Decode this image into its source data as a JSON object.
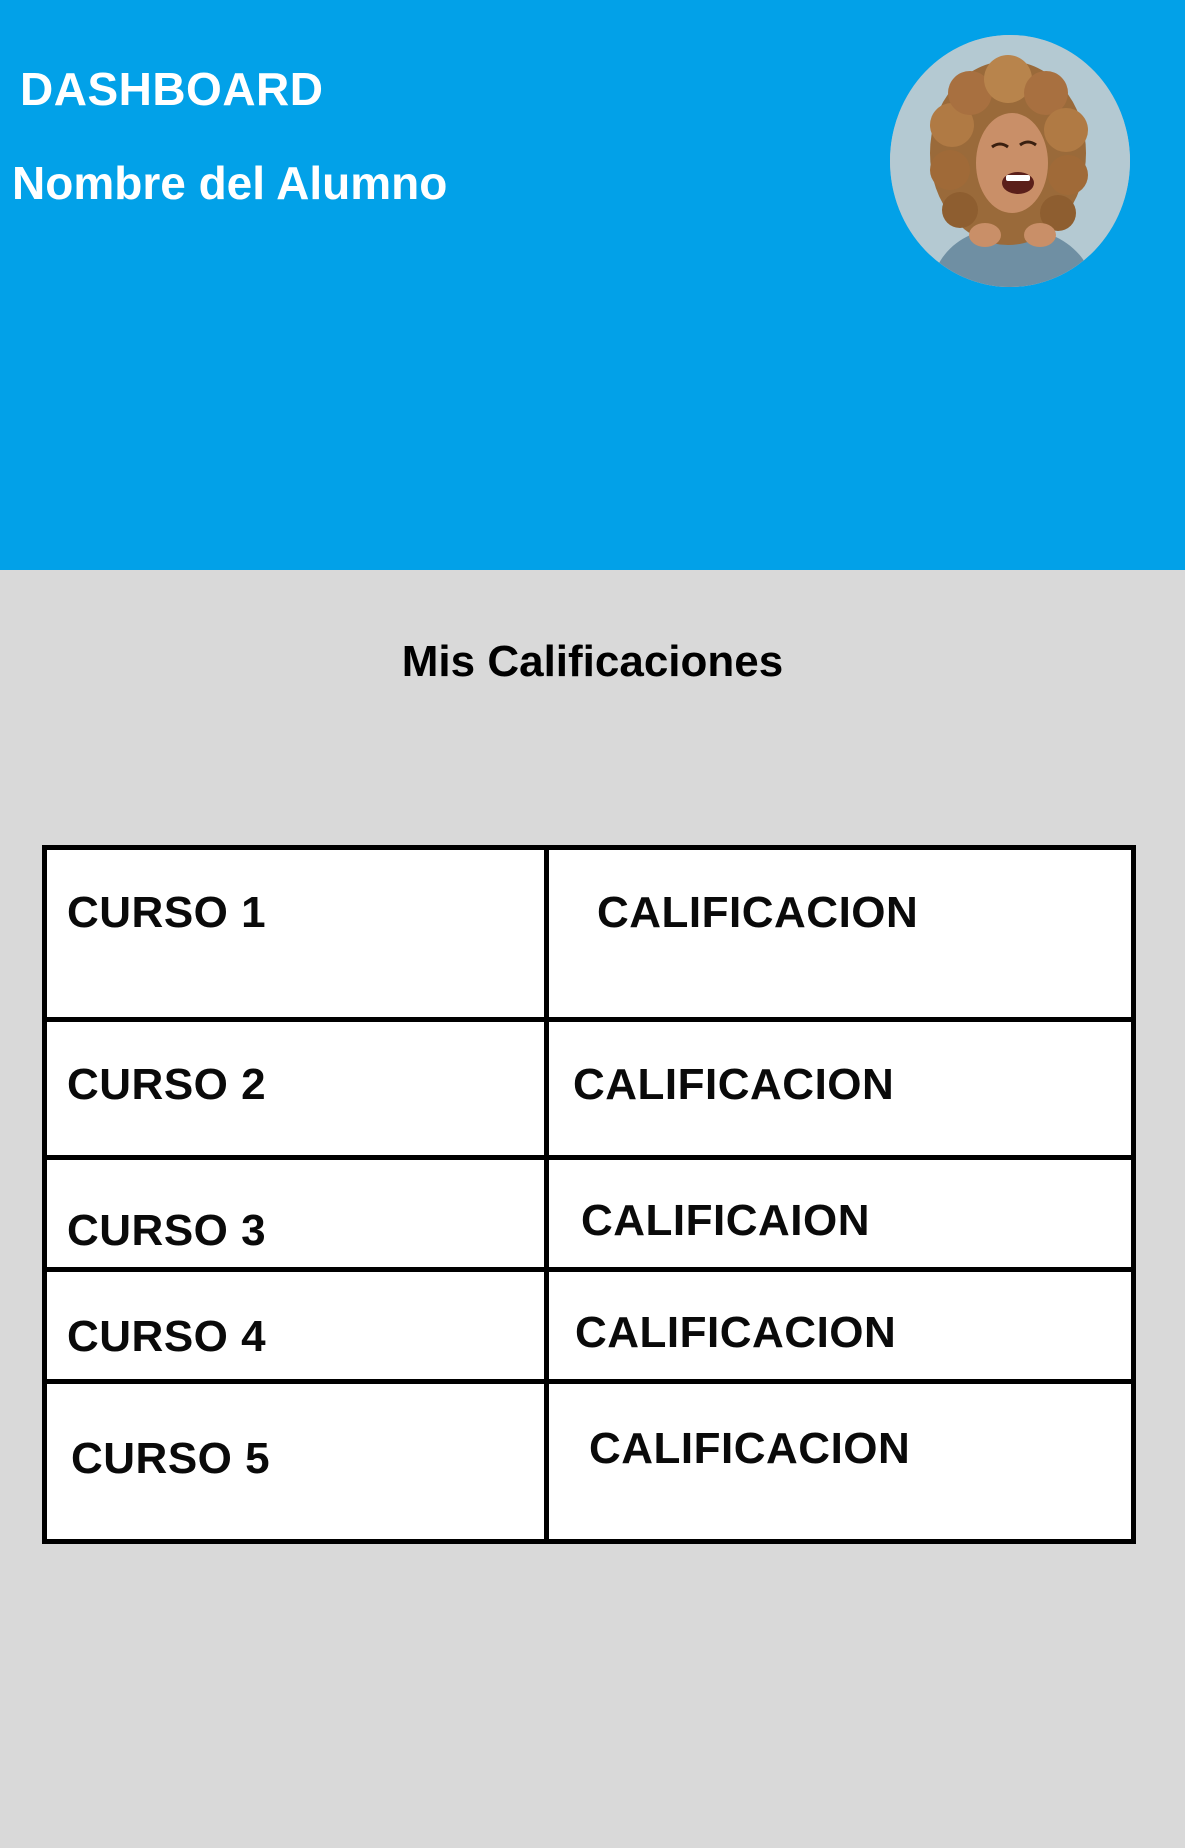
{
  "header": {
    "title": "DASHBOARD",
    "student_name": "Nombre del Alumno",
    "background_color": "#02a1e8",
    "avatar_icon": "student-photo"
  },
  "grades": {
    "title": "Mis Calificaciones",
    "rows": [
      {
        "course": "CURSO 1",
        "grade": "CALIFICACION"
      },
      {
        "course": "CURSO 2",
        "grade": "CALIFICACION"
      },
      {
        "course": "CURSO 3",
        "grade": "CALIFICAION"
      },
      {
        "course": "CURSO 4",
        "grade": "CALIFICACION"
      },
      {
        "course": "CURSO 5",
        "grade": "CALIFICACION"
      }
    ]
  },
  "colors": {
    "page_background": "#d9d9d9",
    "table_border": "#000000",
    "table_background": "#ffffff"
  }
}
